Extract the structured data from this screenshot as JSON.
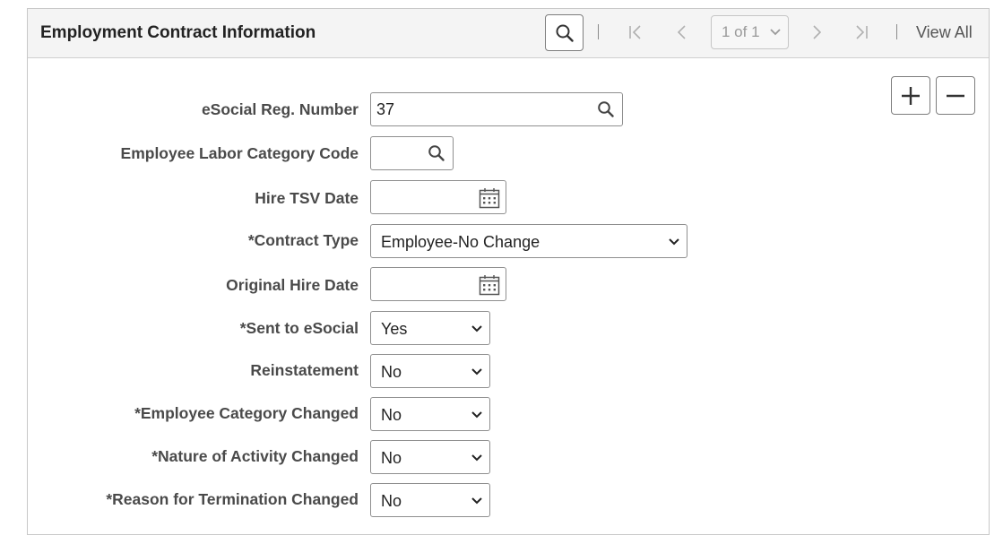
{
  "panel": {
    "title": "Employment Contract Information",
    "pagination": "1 of 1",
    "view_all": "View All",
    "icons": {
      "search": "search-icon",
      "first": "first-page-icon",
      "previous": "previous-page-icon",
      "next": "next-page-icon",
      "last": "last-page-icon",
      "add": "plus-icon",
      "delete": "minus-icon"
    }
  },
  "fields": {
    "esocial_reg_number": {
      "label": "eSocial Reg. Number",
      "value": "37"
    },
    "employee_labor_category_code": {
      "label": "Employee Labor Category Code",
      "value": ""
    },
    "hire_tsv_date": {
      "label": "Hire TSV Date",
      "value": ""
    },
    "contract_type": {
      "label": "*Contract Type",
      "value": "Employee-No Change"
    },
    "original_hire_date": {
      "label": "Original Hire Date",
      "value": ""
    },
    "sent_to_esocial": {
      "label": "*Sent to eSocial",
      "value": "Yes"
    },
    "reinstatement": {
      "label": "Reinstatement",
      "value": "No"
    },
    "employee_category_changed": {
      "label": "*Employee Category Changed",
      "value": "No"
    },
    "nature_of_activity_changed": {
      "label": "*Nature of Activity Changed",
      "value": "No"
    },
    "reason_for_termination_changed": {
      "label": "*Reason for Termination Changed",
      "value": "No"
    }
  },
  "colors": {
    "header_bg": "#f4f4f4",
    "border": "#c8c8c8",
    "label_text": "#4a4a4a",
    "disabled_text": "#9a9a9a"
  }
}
